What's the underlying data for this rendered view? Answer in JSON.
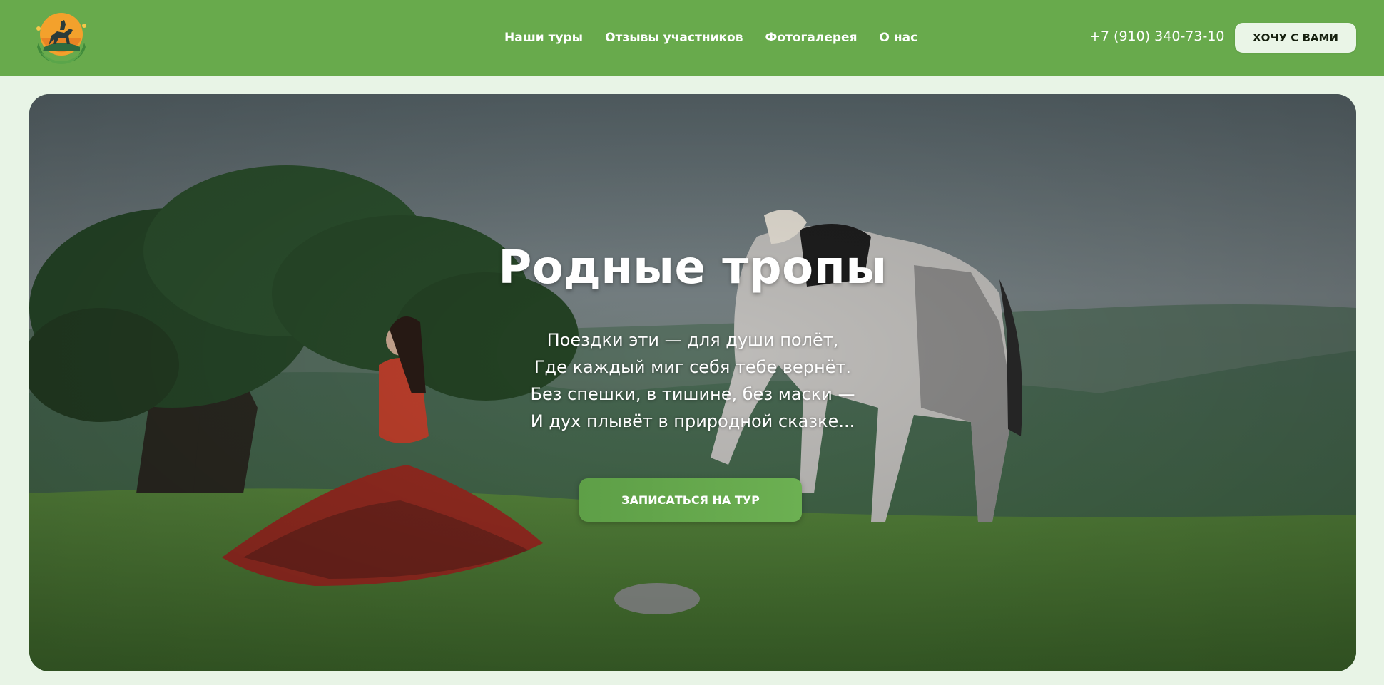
{
  "brand": {
    "logo_icon": "horse-rider-sun-logo"
  },
  "nav": {
    "items": [
      {
        "label": "Наши туры"
      },
      {
        "label": "Отзывы участников"
      },
      {
        "label": "Фотогалерея"
      },
      {
        "label": "О нас"
      }
    ]
  },
  "header": {
    "phone": "+7 (910) 340-73-10",
    "cta_label": "ХОЧУ С ВАМИ"
  },
  "hero": {
    "title": "Родные тропы",
    "poem": [
      "Поездки эти — для души полёт,",
      "Где каждый миг себя тебе вернёт.",
      "Без спешки, в тишине, без маски —",
      "И дух плывёт в природной сказке..."
    ],
    "cta_label": "ЗАПИСАТЬСЯ НА ТУР",
    "image_subject": "woman in red dress sitting on grassy hill beside grazing white horse and windswept tree"
  },
  "colors": {
    "header_bg": "#68aa4c",
    "page_bg": "#e8f4e6",
    "accent": "#5e9f47"
  }
}
